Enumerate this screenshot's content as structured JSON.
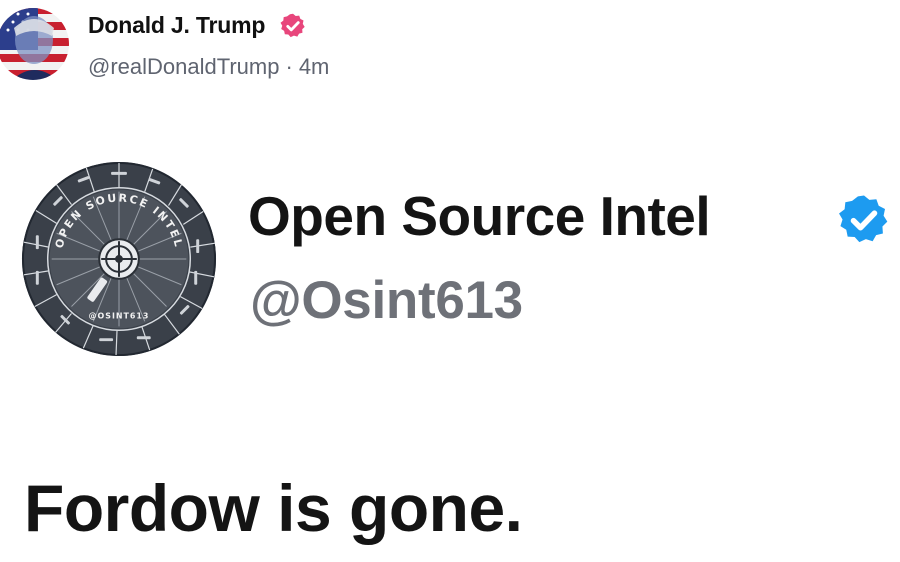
{
  "post": {
    "author_name": "Donald J. Trump",
    "author_handle": "@realDonaldTrump",
    "separator": "·",
    "timestamp": "4m",
    "text": "Fordow is gone.",
    "avatar_icon": "flag-portrait-avatar",
    "verified_icon": "verified-badge-icon",
    "verified_color": "#e8467c"
  },
  "embedded": {
    "display_name": "Open Source Intel",
    "handle": "@Osint613",
    "logo_icon": "osint-wheel-logo",
    "logo_ring_text": "OPEN SOURCE INTEL",
    "logo_center_text": "@OSINT613",
    "verified_icon": "verified-badge-icon",
    "verified_color": "#1d9bf0"
  }
}
